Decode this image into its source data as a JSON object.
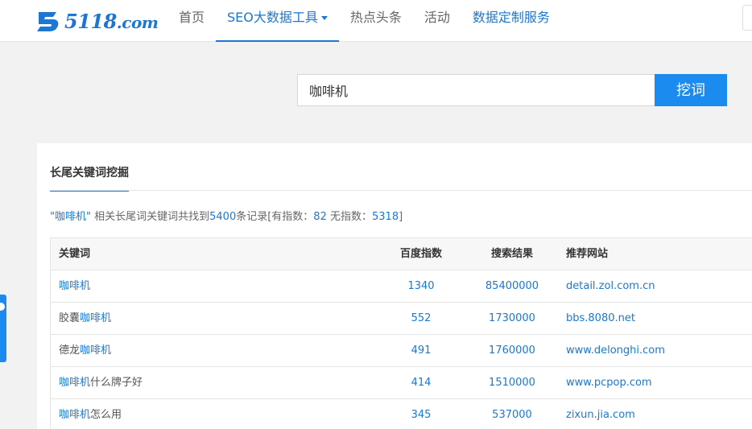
{
  "logo": {
    "main": "5118",
    "suffix": ".com"
  },
  "nav": [
    {
      "label": "首页",
      "active": false
    },
    {
      "label": "SEO大数据工具",
      "active": true,
      "dropdown": true
    },
    {
      "label": "热点头条",
      "active": false
    },
    {
      "label": "活动",
      "active": false
    },
    {
      "label": "数据定制服务",
      "active": false,
      "highlight": true
    }
  ],
  "search": {
    "value": "咖啡机",
    "button_label": "挖词"
  },
  "panel": {
    "tab_label": "长尾关键词挖掘",
    "summary": {
      "keyword_quoted": "\"咖啡机\"",
      "text_before_count": "相关长尾词关键词共找到",
      "total": "5400",
      "text_after_count": "条记录[有指数：",
      "with_index": "82",
      "text_no_index": "无指数：",
      "without_index": "5318",
      "close": "]"
    },
    "table": {
      "headers": [
        "关键词",
        "百度指数",
        "搜索结果",
        "推荐网站"
      ],
      "rows": [
        {
          "prefix": "",
          "keyword": "咖啡机",
          "suffix": "",
          "index": "1340",
          "results": "85400000",
          "site": "detail.zol.com.cn"
        },
        {
          "prefix": "胶囊",
          "keyword": "咖啡机",
          "suffix": "",
          "index": "552",
          "results": "1730000",
          "site": "bbs.8080.net"
        },
        {
          "prefix": "德龙",
          "keyword": "咖啡机",
          "suffix": "",
          "index": "491",
          "results": "1760000",
          "site": "www.delonghi.com"
        },
        {
          "prefix": "",
          "keyword": "咖啡机",
          "suffix": "什么牌子好",
          "index": "414",
          "results": "1510000",
          "site": "www.pcpop.com"
        },
        {
          "prefix": "",
          "keyword": "咖啡机",
          "suffix": "怎么用",
          "index": "345",
          "results": "537000",
          "site": "zixun.jia.com"
        }
      ]
    }
  },
  "colors": {
    "accent": "#1b77d2",
    "button": "#1b8bef",
    "background": "#f2f2f2"
  },
  "icons": {
    "logo": "5118-logo-icon",
    "dropdown": "caret-down-icon",
    "side": "float-contact-icon"
  }
}
